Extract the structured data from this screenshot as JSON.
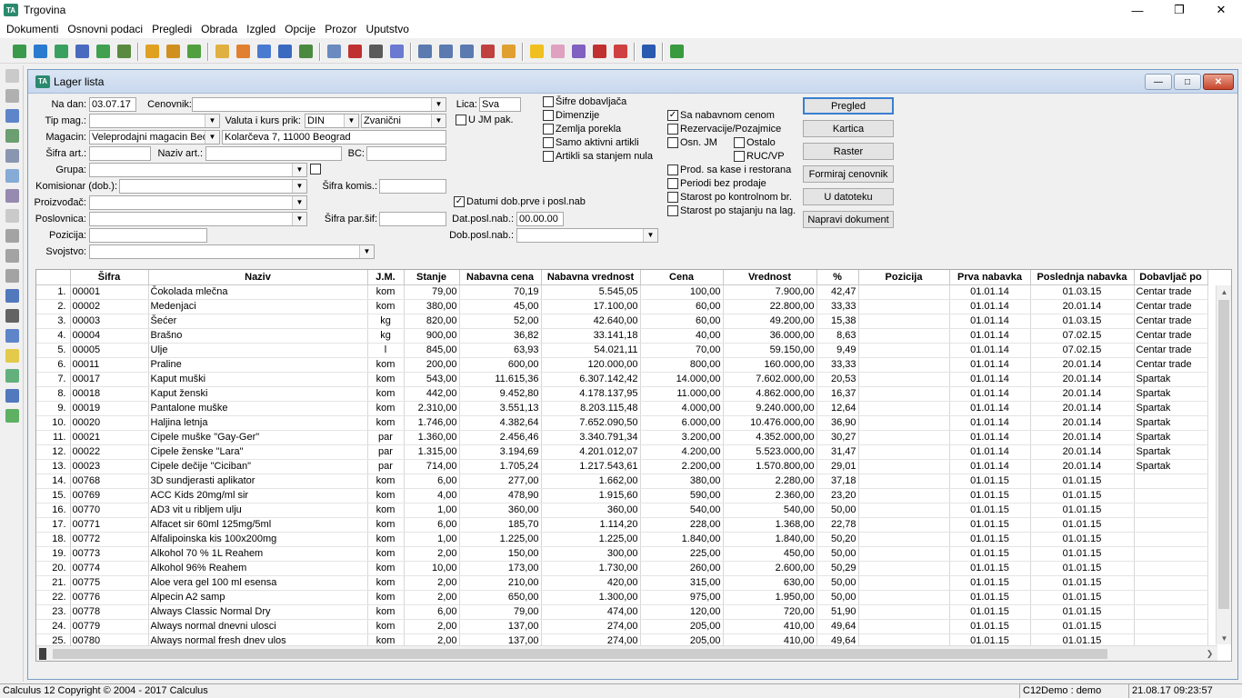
{
  "app": {
    "title": "Trgovina",
    "logo": "TA"
  },
  "menu": [
    "Dokumenti",
    "Osnovni podaci",
    "Pregledi",
    "Obrada",
    "Izgled",
    "Opcije",
    "Prozor",
    "Uputstvo"
  ],
  "window": {
    "title": "Lager lista"
  },
  "form": {
    "na_dan_label": "Na dan:",
    "na_dan": "03.07.17",
    "cenovnik_label": "Cenovnik:",
    "cenovnik": "",
    "tip_mag_label": "Tip mag.:",
    "tip_mag": "",
    "valuta_label": "Valuta i kurs prik:",
    "valuta": "DIN",
    "kurs": "Zvanični",
    "magacin_label": "Magacin:",
    "magacin": "Veleprodajni magacin Beo",
    "magacin_adresa": "Kolarčeva 7, 11000 Beograd",
    "sifra_art_label": "Šifra art.:",
    "sifra_art": "",
    "naziv_art_label": "Naziv art.:",
    "naziv_art": "",
    "bc_label": "BC:",
    "bc": "",
    "grupa_label": "Grupa:",
    "grupa": "",
    "komisionar_label": "Komisionar (dob.):",
    "komisionar": "",
    "sifra_komis_label": "Šifra komis.:",
    "sifra_komis": "",
    "proizvodjac_label": "Proizvođač:",
    "proizvodjac": "",
    "poslovnica_label": "Poslovnica:",
    "poslovnica": "",
    "sifra_par_label": "Šifra par.šif:",
    "sifra_par": "",
    "pozicija_label": "Pozicija:",
    "pozicija": "",
    "svojstvo_label": "Svojstvo:",
    "svojstvo": "",
    "lica_label": "Lica:",
    "lica": "Sva",
    "u_jm_pak": "U JM pak.",
    "datumi_dob": "Datumi dob.prve i posl.nab",
    "dat_posl_nab_label": "Dat.posl.nab.:",
    "dat_posl_nab": "00.00.00",
    "dob_posl_nab_label": "Dob.posl.nab.:",
    "dob_posl_nab": ""
  },
  "checks_mid": [
    "Šifre dobavljača",
    "Dimenzije",
    "Zemlja porekla",
    "Samo aktivni artikli",
    "Artikli sa stanjem nula"
  ],
  "checks_right": {
    "sa_nabavnom": "Sa nabavnom cenom",
    "rezervacije": "Rezervacije/Pozajmice",
    "osn_jm": "Osn. JM",
    "ostalo": "Ostalo",
    "ruc_vp": "RUC/VP",
    "prod_kase": "Prod. sa kase i restorana",
    "periodi": "Periodi bez prodaje",
    "starost_kontrolnom": "Starost po kontrolnom br.",
    "starost_stanju": "Starost po stajanju na lag."
  },
  "buttons": [
    "Pregled",
    "Kartica",
    "Raster",
    "Formiraj cenovnik",
    "U datoteku",
    "Napravi dokument"
  ],
  "table": {
    "headers": [
      "",
      "Šifra",
      "Naziv",
      "J.M.",
      "Stanje",
      "Nabavna cena",
      "Nabavna vrednost",
      "Cena",
      "Vrednost",
      "%",
      "Pozicija",
      "Prva nabavka",
      "Poslednja nabavka",
      "Dobavljač po"
    ],
    "rows": [
      [
        "1.",
        "00001",
        "Čokolada mlečna",
        "kom",
        "79,00",
        "70,19",
        "5.545,05",
        "100,00",
        "7.900,00",
        "42,47",
        "",
        "01.01.14",
        "01.03.15",
        "Centar trade"
      ],
      [
        "2.",
        "00002",
        "Medenjaci",
        "kom",
        "380,00",
        "45,00",
        "17.100,00",
        "60,00",
        "22.800,00",
        "33,33",
        "",
        "01.01.14",
        "20.01.14",
        "Centar trade"
      ],
      [
        "3.",
        "00003",
        "Šećer",
        "kg",
        "820,00",
        "52,00",
        "42.640,00",
        "60,00",
        "49.200,00",
        "15,38",
        "",
        "01.01.14",
        "01.03.15",
        "Centar trade"
      ],
      [
        "4.",
        "00004",
        "Brašno",
        "kg",
        "900,00",
        "36,82",
        "33.141,18",
        "40,00",
        "36.000,00",
        "8,63",
        "",
        "01.01.14",
        "07.02.15",
        "Centar trade"
      ],
      [
        "5.",
        "00005",
        "Ulje",
        "l",
        "845,00",
        "63,93",
        "54.021,11",
        "70,00",
        "59.150,00",
        "9,49",
        "",
        "01.01.14",
        "07.02.15",
        "Centar trade"
      ],
      [
        "6.",
        "00011",
        "Praline",
        "kom",
        "200,00",
        "600,00",
        "120.000,00",
        "800,00",
        "160.000,00",
        "33,33",
        "",
        "01.01.14",
        "20.01.14",
        "Centar trade"
      ],
      [
        "7.",
        "00017",
        "Kaput muški",
        "kom",
        "543,00",
        "11.615,36",
        "6.307.142,42",
        "14.000,00",
        "7.602.000,00",
        "20,53",
        "",
        "01.01.14",
        "20.01.14",
        "Spartak"
      ],
      [
        "8.",
        "00018",
        "Kaput ženski",
        "kom",
        "442,00",
        "9.452,80",
        "4.178.137,95",
        "11.000,00",
        "4.862.000,00",
        "16,37",
        "",
        "01.01.14",
        "20.01.14",
        "Spartak"
      ],
      [
        "9.",
        "00019",
        "Pantalone muške",
        "kom",
        "2.310,00",
        "3.551,13",
        "8.203.115,48",
        "4.000,00",
        "9.240.000,00",
        "12,64",
        "",
        "01.01.14",
        "20.01.14",
        "Spartak"
      ],
      [
        "10.",
        "00020",
        "Haljina letnja",
        "kom",
        "1.746,00",
        "4.382,64",
        "7.652.090,50",
        "6.000,00",
        "10.476.000,00",
        "36,90",
        "",
        "01.01.14",
        "20.01.14",
        "Spartak"
      ],
      [
        "11.",
        "00021",
        "Cipele muške \"Gay-Ger\"",
        "par",
        "1.360,00",
        "2.456,46",
        "3.340.791,34",
        "3.200,00",
        "4.352.000,00",
        "30,27",
        "",
        "01.01.14",
        "20.01.14",
        "Spartak"
      ],
      [
        "12.",
        "00022",
        "Cipele ženske \"Lara\"",
        "par",
        "1.315,00",
        "3.194,69",
        "4.201.012,07",
        "4.200,00",
        "5.523.000,00",
        "31,47",
        "",
        "01.01.14",
        "20.01.14",
        "Spartak"
      ],
      [
        "13.",
        "00023",
        "Cipele dečije \"Ciciban\"",
        "par",
        "714,00",
        "1.705,24",
        "1.217.543,61",
        "2.200,00",
        "1.570.800,00",
        "29,01",
        "",
        "01.01.14",
        "20.01.14",
        "Spartak"
      ],
      [
        "14.",
        "00768",
        "3D sundjerasti aplikator",
        "kom",
        "6,00",
        "277,00",
        "1.662,00",
        "380,00",
        "2.280,00",
        "37,18",
        "",
        "01.01.15",
        "01.01.15",
        ""
      ],
      [
        "15.",
        "00769",
        "ACC Kids 20mg/ml sir",
        "kom",
        "4,00",
        "478,90",
        "1.915,60",
        "590,00",
        "2.360,00",
        "23,20",
        "",
        "01.01.15",
        "01.01.15",
        ""
      ],
      [
        "16.",
        "00770",
        "AD3 vit u ribljem ulju",
        "kom",
        "1,00",
        "360,00",
        "360,00",
        "540,00",
        "540,00",
        "50,00",
        "",
        "01.01.15",
        "01.01.15",
        ""
      ],
      [
        "17.",
        "00771",
        "Alfacet sir 60ml 125mg/5ml",
        "kom",
        "6,00",
        "185,70",
        "1.114,20",
        "228,00",
        "1.368,00",
        "22,78",
        "",
        "01.01.15",
        "01.01.15",
        ""
      ],
      [
        "18.",
        "00772",
        "Alfalipoinska kis 100x200mg",
        "kom",
        "1,00",
        "1.225,00",
        "1.225,00",
        "1.840,00",
        "1.840,00",
        "50,20",
        "",
        "01.01.15",
        "01.01.15",
        ""
      ],
      [
        "19.",
        "00773",
        "Alkohol 70 %  1L Reahem",
        "kom",
        "2,00",
        "150,00",
        "300,00",
        "225,00",
        "450,00",
        "50,00",
        "",
        "01.01.15",
        "01.01.15",
        ""
      ],
      [
        "20.",
        "00774",
        "Alkohol 96% Reahem",
        "kom",
        "10,00",
        "173,00",
        "1.730,00",
        "260,00",
        "2.600,00",
        "50,29",
        "",
        "01.01.15",
        "01.01.15",
        ""
      ],
      [
        "21.",
        "00775",
        "Aloe vera gel 100 ml esensa",
        "kom",
        "2,00",
        "210,00",
        "420,00",
        "315,00",
        "630,00",
        "50,00",
        "",
        "01.01.15",
        "01.01.15",
        ""
      ],
      [
        "22.",
        "00776",
        "Alpecin A2 samp",
        "kom",
        "2,00",
        "650,00",
        "1.300,00",
        "975,00",
        "1.950,00",
        "50,00",
        "",
        "01.01.15",
        "01.01.15",
        ""
      ],
      [
        "23.",
        "00778",
        "Always Classic Normal Dry",
        "kom",
        "6,00",
        "79,00",
        "474,00",
        "120,00",
        "720,00",
        "51,90",
        "",
        "01.01.15",
        "01.01.15",
        ""
      ],
      [
        "24.",
        "00779",
        "Always normal dnevni ulosci",
        "kom",
        "2,00",
        "137,00",
        "274,00",
        "205,00",
        "410,00",
        "49,64",
        "",
        "01.01.15",
        "01.01.15",
        ""
      ],
      [
        "25.",
        "00780",
        "Always normal fresh dnev ulos",
        "kom",
        "2,00",
        "137,00",
        "274,00",
        "205,00",
        "410,00",
        "49,64",
        "",
        "01.01.15",
        "01.01.15",
        ""
      ]
    ]
  },
  "status": {
    "copyright": "Calculus 12  Copyright © 2004 - 2017  Calculus",
    "user": "C12Demo : demo",
    "datetime": "21.08.17 09:23:57"
  }
}
